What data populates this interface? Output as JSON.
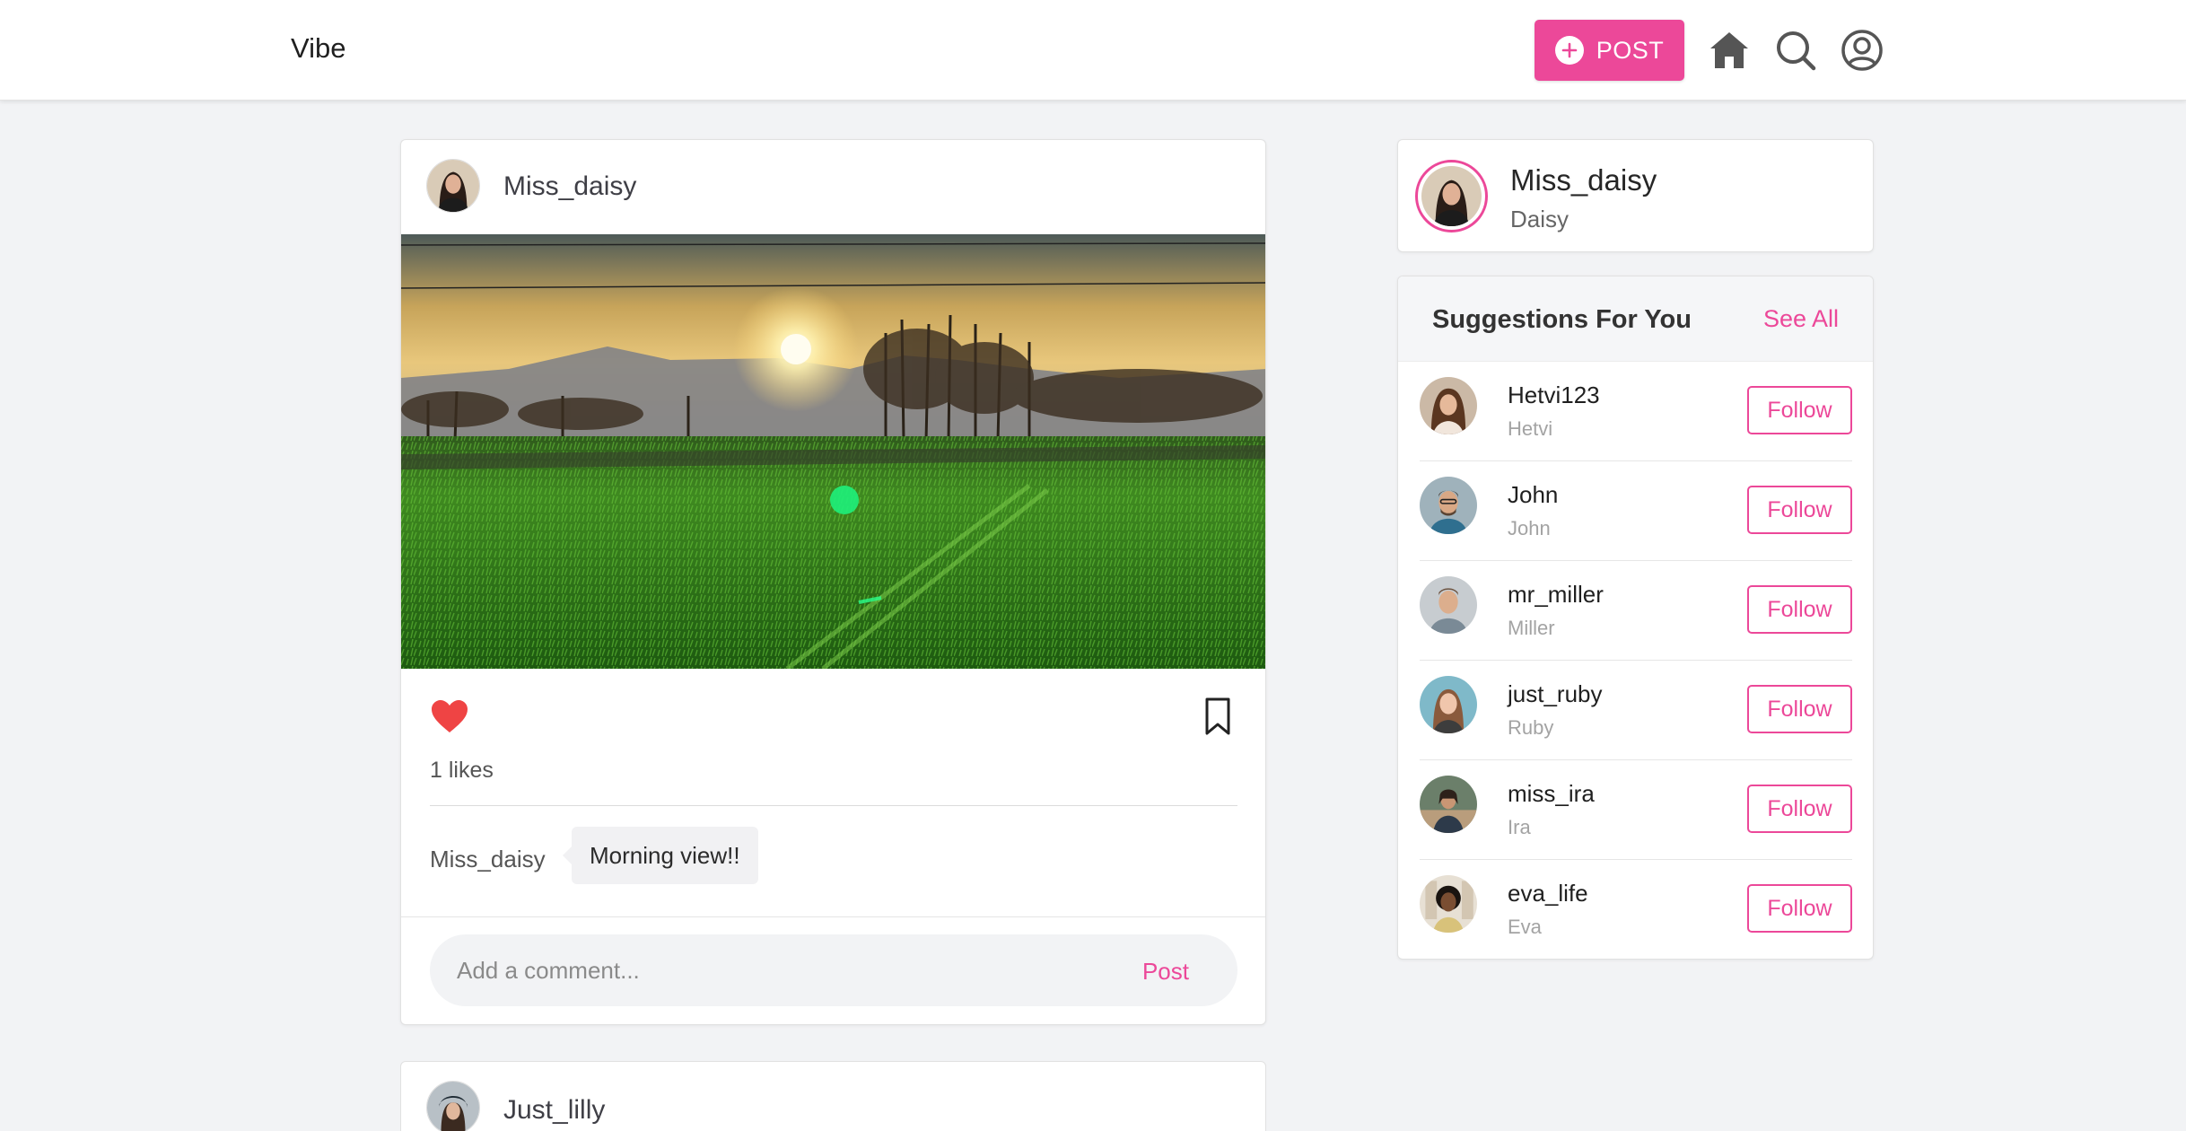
{
  "header": {
    "brand": "Vibe",
    "post_label": "POST"
  },
  "colors": {
    "accent": "#ec4899",
    "like": "#ef4444"
  },
  "icons": [
    "plus-circle-icon",
    "home-icon",
    "search-icon",
    "user-circle-icon",
    "heart-icon",
    "bookmark-icon"
  ],
  "post": {
    "username": "Miss_daisy",
    "likes_text": "1 likes",
    "caption_user": "Miss_daisy",
    "caption": "Morning view!!",
    "comment_placeholder": "Add a comment...",
    "comment_post_label": "Post"
  },
  "next_post": {
    "username": "Just_lilly"
  },
  "profile": {
    "username": "Miss_daisy",
    "name": "Daisy"
  },
  "suggestions": {
    "title": "Suggestions For You",
    "see_all": "See All",
    "follow_label": "Follow",
    "items": [
      {
        "username": "Hetvi123",
        "name": "Hetvi"
      },
      {
        "username": "John",
        "name": "John"
      },
      {
        "username": "mr_miller",
        "name": "Miller"
      },
      {
        "username": "just_ruby",
        "name": "Ruby"
      },
      {
        "username": "miss_ira",
        "name": "Ira"
      },
      {
        "username": "eva_life",
        "name": "Eva"
      }
    ]
  }
}
